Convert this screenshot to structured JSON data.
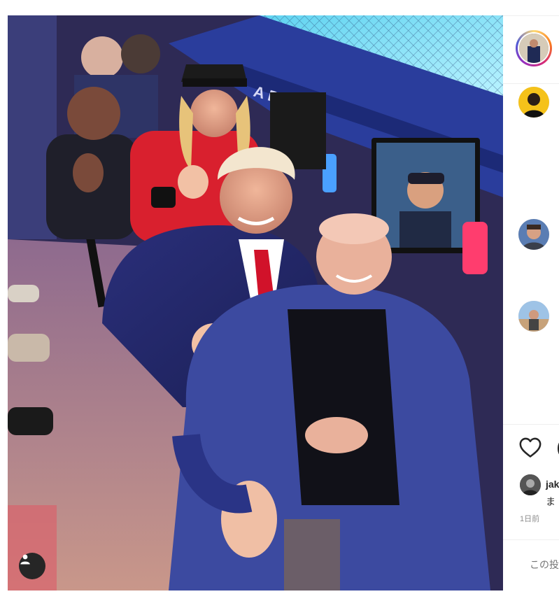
{
  "post": {
    "image_alt": "",
    "tag_button_icon": "user-tag-icon"
  },
  "side": {
    "author_avatar_icon": "story-avatar",
    "comments": [
      {
        "avatar": "commenter-avatar-1"
      },
      {
        "avatar": "commenter-avatar-2"
      },
      {
        "avatar": "commenter-avatar-3"
      }
    ],
    "like_icon": "heart-icon",
    "comment_icon": "comment-icon",
    "liker_username": "jak",
    "caption_fragment": "ま",
    "time_ago": "1日前",
    "comment_placeholder": "この投稿"
  },
  "colors": {
    "stage_blue": "#2a3d9c",
    "cage_cyan": "#7fe0f5",
    "floor": "#b98c84",
    "text": "#262626",
    "muted": "#8e8e8e"
  }
}
